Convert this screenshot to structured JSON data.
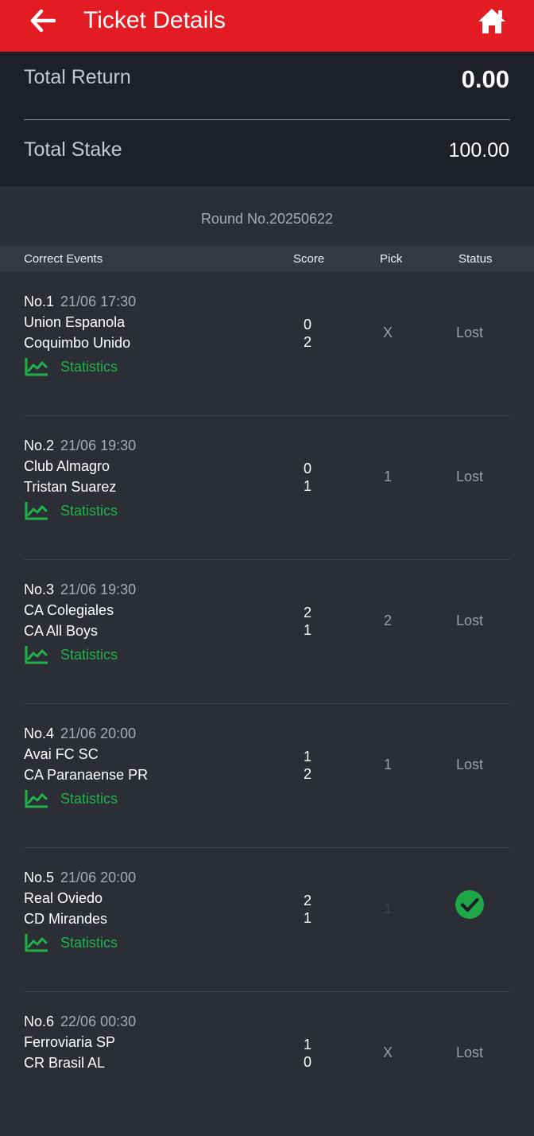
{
  "header": {
    "title": "Ticket Details",
    "back_icon": "arrow-left-icon",
    "home_icon": "home-icon",
    "bar_color": "#e31b23"
  },
  "summary": {
    "total_return_label": "Total Return",
    "total_return_value": "0.00",
    "total_stake_label": "Total Stake",
    "total_stake_value": "100.00"
  },
  "round": "Round No.20250622",
  "columns": {
    "events": "Correct Events",
    "score": "Score",
    "pick": "Pick",
    "status": "Status"
  },
  "statistics_label": "Statistics",
  "events": [
    {
      "no": "No.1",
      "time": "21/06 17:30",
      "team1": "Union Espanola",
      "team2": "Coquimbo Unido",
      "score1": "0",
      "score2": "2",
      "pick": "X",
      "status": "Lost"
    },
    {
      "no": "No.2",
      "time": "21/06 19:30",
      "team1": "Club Almagro",
      "team2": "Tristan Suarez",
      "score1": "0",
      "score2": "1",
      "pick": "1",
      "status": "Lost"
    },
    {
      "no": "No.3",
      "time": "21/06 19:30",
      "team1": "CA Colegiales",
      "team2": "CA All Boys",
      "score1": "2",
      "score2": "1",
      "pick": "2",
      "status": "Lost"
    },
    {
      "no": "No.4",
      "time": "21/06 20:00",
      "team1": "Avai FC SC",
      "team2": "CA Paranaense PR",
      "score1": "1",
      "score2": "2",
      "pick": "1",
      "status": "Lost"
    },
    {
      "no": "No.5",
      "time": "21/06 20:00",
      "team1": "Real Oviedo",
      "team2": "CD Mirandes",
      "score1": "2",
      "score2": "1",
      "pick": "1",
      "status": "",
      "status_icon": "check-circle-icon",
      "status_color": "#1fa84a"
    },
    {
      "no": "No.6",
      "time": "22/06 00:30",
      "team1": "Ferroviaria SP",
      "team2": "CR Brasil AL",
      "score1": "1",
      "score2": "0",
      "pick": "X",
      "status": "Lost"
    }
  ],
  "colors": {
    "accent_green": "#22b14c",
    "summary_bg": "#1d2027",
    "list_bg": "#2b2e35"
  }
}
